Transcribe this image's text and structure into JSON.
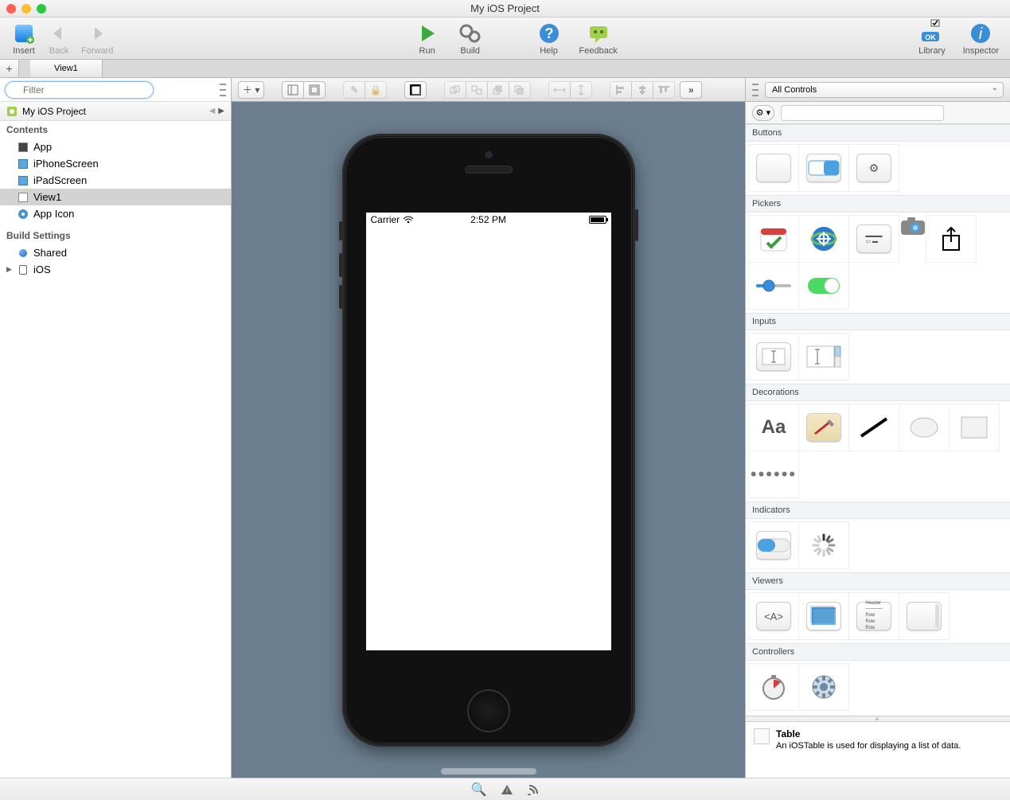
{
  "window": {
    "title": "My iOS Project"
  },
  "toolbar": {
    "insert": "Insert",
    "back": "Back",
    "forward": "Forward",
    "run": "Run",
    "build": "Build",
    "help": "Help",
    "feedback": "Feedback",
    "library": "Library",
    "inspector": "Inspector"
  },
  "tabs": {
    "active": "View1"
  },
  "left": {
    "filter_placeholder": "Filter",
    "project_name": "My iOS Project",
    "contents_label": "Contents",
    "items": {
      "app": "App",
      "iphone": "iPhoneScreen",
      "ipad": "iPadScreen",
      "view1": "View1",
      "appicon": "App Icon"
    },
    "build_settings_label": "Build Settings",
    "shared": "Shared",
    "ios": "iOS"
  },
  "device": {
    "carrier": "Carrier",
    "time": "2:52 PM"
  },
  "right": {
    "dropdown": "All Controls",
    "sections": {
      "buttons": "Buttons",
      "pickers": "Pickers",
      "inputs": "Inputs",
      "decorations": "Decorations",
      "indicators": "Indicators",
      "viewers": "Viewers",
      "controllers": "Controllers"
    },
    "info": {
      "title": "Table",
      "desc": "An iOSTable is used for displaying a list of data."
    }
  }
}
